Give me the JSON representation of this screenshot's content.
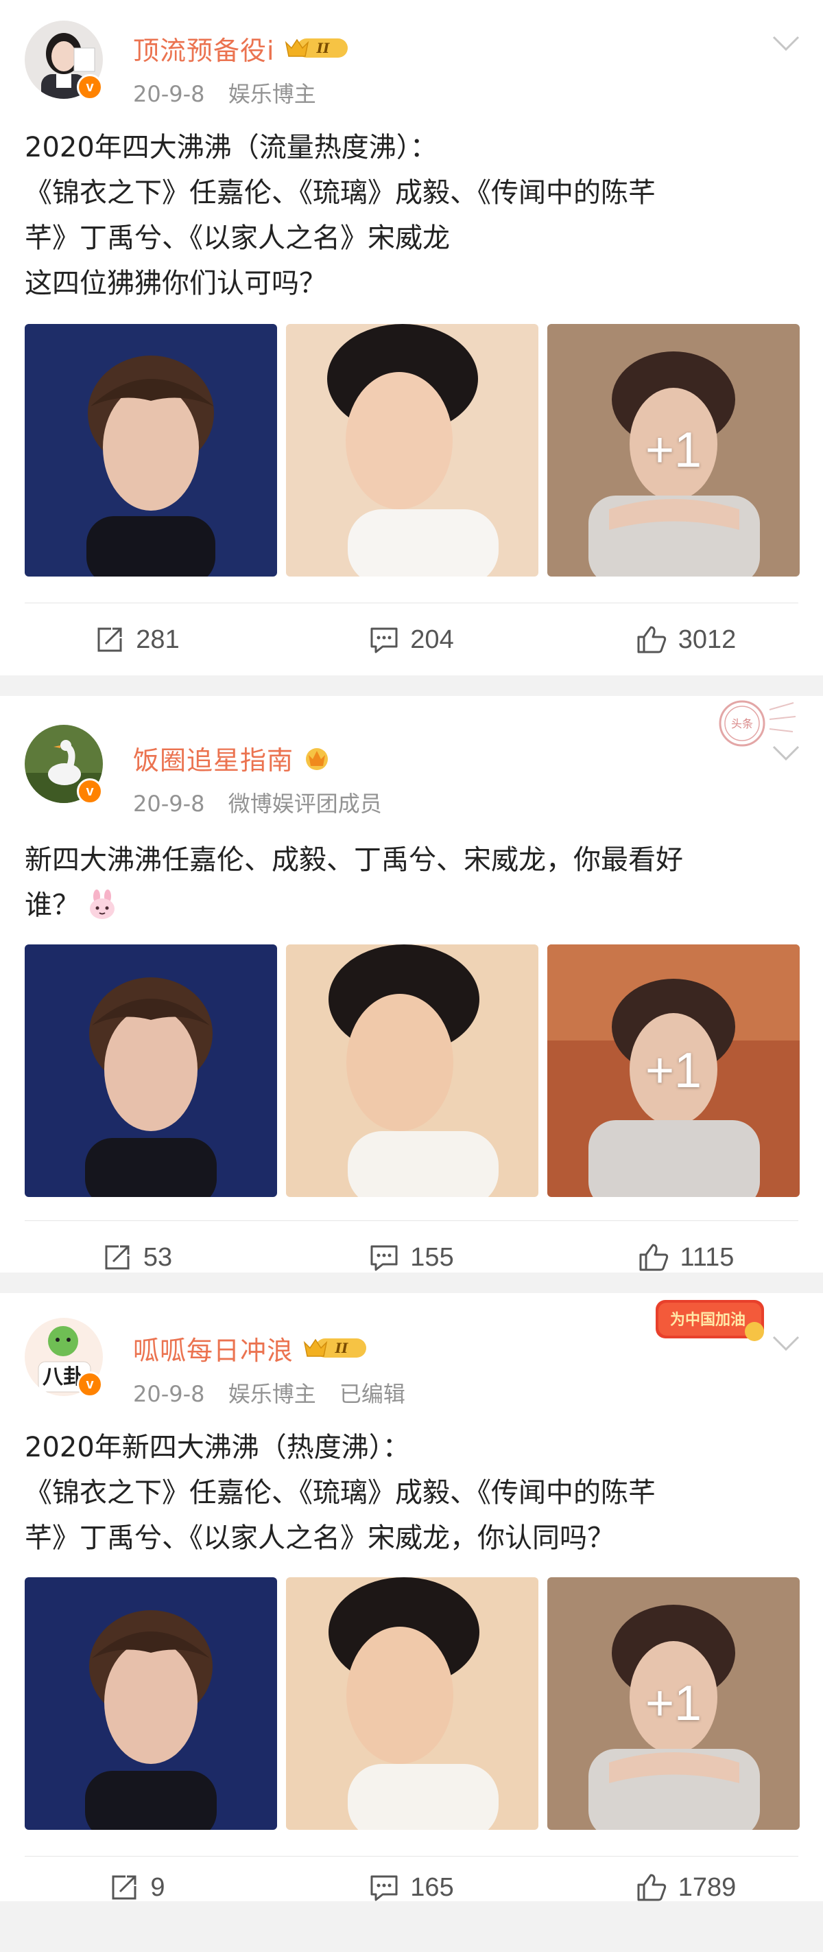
{
  "posts": [
    {
      "user_name": "顶流预备役i",
      "level_badge": "II",
      "date": "20-9-8",
      "tag": "娱乐博主",
      "edited": "",
      "text_lines": [
        "2020年四大沸沸（流量热度沸）：",
        "《锦衣之下》任嘉伦、《琉璃》成毅、《传闻中的陈芊",
        "芊》丁禹兮、《以家人之名》宋威龙",
        "这四位狒狒你们认可吗？"
      ],
      "more_images": "+1",
      "reposts": "281",
      "comments": "204",
      "likes": "3012"
    },
    {
      "user_name": "饭圈追星指南",
      "level_badge": "",
      "date": "20-9-8",
      "tag": "微博娱评团成员",
      "edited": "",
      "text_lines": [
        "新四大沸沸任嘉伦、成毅、丁禹兮、宋威龙，你最看好",
        "谁？"
      ],
      "more_images": "+1",
      "reposts": "53",
      "comments": "155",
      "likes": "1115"
    },
    {
      "user_name": "呱呱每日冲浪",
      "level_badge": "II",
      "date": "20-9-8",
      "tag": "娱乐博主",
      "edited": "已编辑",
      "text_lines": [
        "2020年新四大沸沸（热度沸）：",
        "《锦衣之下》任嘉伦、《琉璃》成毅、《传闻中的陈芊",
        "芊》丁禹兮、《以家人之名》宋威龙，你认同吗？"
      ],
      "more_images": "+1",
      "reposts": "9",
      "comments": "165",
      "likes": "1789"
    }
  ],
  "icons": {
    "verified": "v-badge-icon",
    "level": "crown-level-badge-icon",
    "menu": "chevron-down-icon",
    "repost": "repost-icon",
    "comment": "comment-icon",
    "like": "thumbs-up-icon",
    "emoji": "bunny-emoji-icon"
  },
  "colors": {
    "username": "#eb7350",
    "verified_badge": "#ff8200",
    "meta_text": "#939393",
    "body_text": "#222222",
    "separator": "#f2f2f2"
  },
  "badge_texts": {
    "verified": "v",
    "stamp": "头条",
    "event_badge": "为中国加油"
  }
}
